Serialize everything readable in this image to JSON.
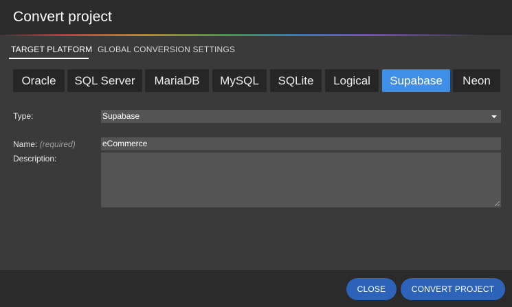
{
  "dialog": {
    "title": "Convert project"
  },
  "tabs": [
    {
      "label": "TARGET PLATFORM",
      "active": true
    },
    {
      "label": "GLOBAL CONVERSION SETTINGS",
      "active": false
    }
  ],
  "platforms": {
    "selected": "Supabase",
    "items": [
      "Oracle",
      "SQL Server",
      "MariaDB",
      "MySQL",
      "SQLite",
      "Logical",
      "Supabase",
      "Neon"
    ]
  },
  "form": {
    "type_label": "Type:",
    "type_value": "Supabase",
    "name_label": "Name:",
    "name_required": "(required)",
    "name_value": "eCommerce",
    "description_label": "Description:",
    "description_value": ""
  },
  "footer": {
    "close_label": "CLOSE",
    "convert_label": "CONVERT PROJECT"
  },
  "colors": {
    "accent": "#3f8fe8",
    "footer_button": "#2d63b8",
    "background": "#3a3a3a",
    "titlebar": "#2b2b2b"
  },
  "icons": {
    "type_dropdown": "chevron-down-icon",
    "textarea_resize": "resize-grip-icon"
  }
}
